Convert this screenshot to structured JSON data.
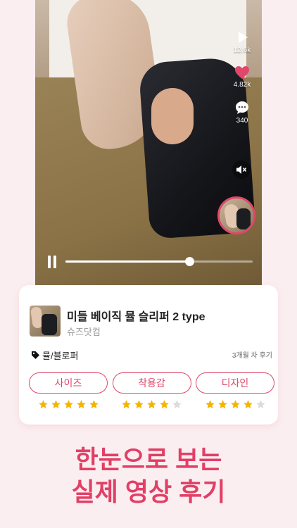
{
  "video": {
    "play_count": "12.6k",
    "like_count": "4.82k",
    "comment_count": "340",
    "progress_fraction": 0.66,
    "is_playing": true,
    "muted": true
  },
  "product": {
    "name": "미들 베이직 뮬 슬리퍼 2 type",
    "brand": "슈즈닷컴",
    "category_tag": "뮬/블로퍼",
    "review_age": "3개월 차  후기"
  },
  "ratings": [
    {
      "label": "사이즈",
      "stars": 5,
      "max": 5
    },
    {
      "label": "착용감",
      "stars": 4,
      "max": 5
    },
    {
      "label": "디자인",
      "stars": 4,
      "max": 5
    }
  ],
  "headline": {
    "line1": "한눈으로 보는",
    "line2": "실제 영상 후기"
  },
  "colors": {
    "accent": "#e0476a",
    "headline": "#e23f66",
    "star_on": "#f4b400",
    "star_off": "#dcdcdc",
    "background": "#fbeef0"
  }
}
